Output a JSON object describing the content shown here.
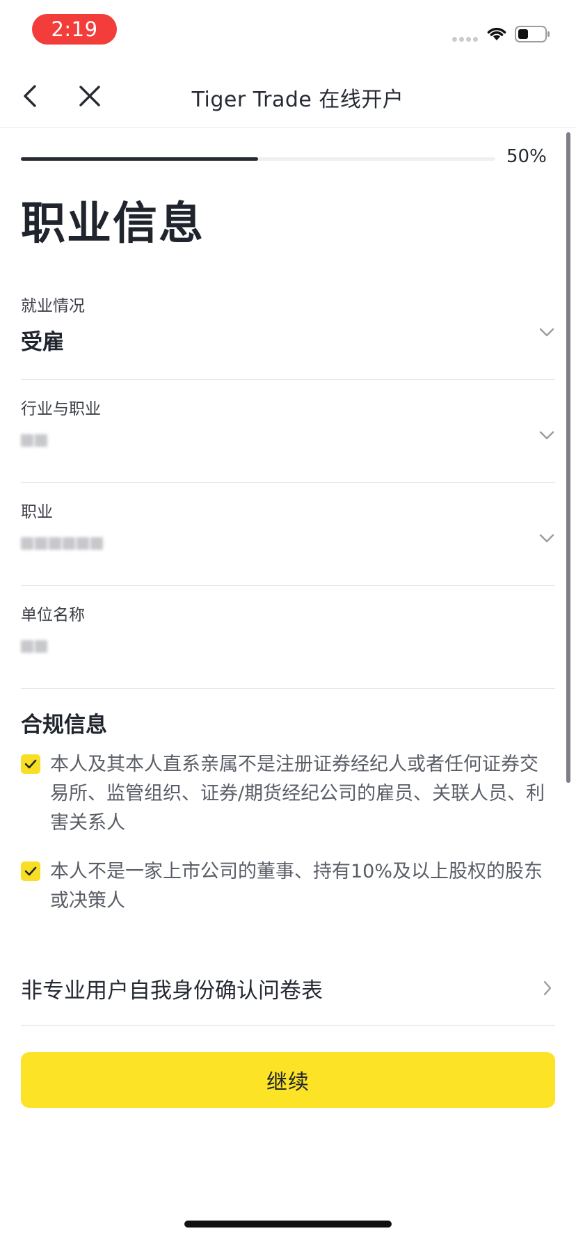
{
  "status_bar": {
    "time": "2:19"
  },
  "nav": {
    "title": "Tiger Trade 在线开户"
  },
  "progress": {
    "percent_label": "50%",
    "value": 0.5
  },
  "page_title": "职业信息",
  "fields": [
    {
      "label": "就业情况",
      "value": "受雇"
    },
    {
      "label": "行业与职业",
      "value": ""
    },
    {
      "label": "职业",
      "value": ""
    },
    {
      "label": "单位名称",
      "value": ""
    }
  ],
  "compliance": {
    "title": "合规信息",
    "items": [
      {
        "text": "本人及其本人直系亲属不是注册证券经纪人或者任何证券交易所、监管组织、证券/期货经纪公司的雇员、关联人员、利害关系人",
        "checked": true
      },
      {
        "text": "本人不是一家上市公司的董事、持有10%及以上股权的股东或决策人",
        "checked": true
      }
    ]
  },
  "questionnaire_link": "非专业用户自我身份确认问卷表",
  "continue_label": "继续",
  "colors": {
    "accent": "#fce326",
    "status_time": "#f23d3a",
    "text_dark": "#20242d"
  }
}
